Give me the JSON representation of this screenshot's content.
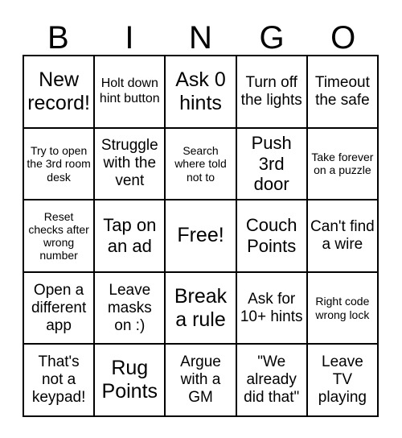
{
  "header": {
    "letters": [
      "B",
      "I",
      "N",
      "G",
      "O"
    ]
  },
  "grid": {
    "columns": 5,
    "rows": 5,
    "border_color": "#000000",
    "cell_background": "#ffffff",
    "text_color": "#000000",
    "cells": [
      {
        "text": "New record!",
        "size": "fs-xl"
      },
      {
        "text": "Holt down hint button",
        "size": "fs-sm"
      },
      {
        "text": "Ask 0 hints",
        "size": "fs-xl"
      },
      {
        "text": "Turn off the lights",
        "size": "fs-md"
      },
      {
        "text": "Timeout the safe",
        "size": "fs-md"
      },
      {
        "text": "Try to open the 3rd room desk",
        "size": "fs-xs"
      },
      {
        "text": "Struggle with the vent",
        "size": "fs-md"
      },
      {
        "text": "Search where told not to",
        "size": "fs-xs"
      },
      {
        "text": "Push 3rd door",
        "size": "fs-lg"
      },
      {
        "text": "Take forever on a puzzle",
        "size": "fs-xs"
      },
      {
        "text": "Reset checks after wrong number",
        "size": "fs-xs"
      },
      {
        "text": "Tap on an ad",
        "size": "fs-lg"
      },
      {
        "text": "Free!",
        "size": "fs-xl"
      },
      {
        "text": "Couch Points",
        "size": "fs-lg"
      },
      {
        "text": "Can't find a wire",
        "size": "fs-md"
      },
      {
        "text": "Open a different app",
        "size": "fs-md"
      },
      {
        "text": "Leave masks on :)",
        "size": "fs-md"
      },
      {
        "text": "Break a rule",
        "size": "fs-xl"
      },
      {
        "text": "Ask for 10+ hints",
        "size": "fs-md"
      },
      {
        "text": "Right code wrong lock",
        "size": "fs-xs"
      },
      {
        "text": "That's not a keypad!",
        "size": "fs-md"
      },
      {
        "text": "Rug Points",
        "size": "fs-xl"
      },
      {
        "text": "Argue with a GM",
        "size": "fs-md"
      },
      {
        "text": "\"We already did that\"",
        "size": "fs-md"
      },
      {
        "text": "Leave TV playing",
        "size": "fs-md"
      }
    ]
  }
}
